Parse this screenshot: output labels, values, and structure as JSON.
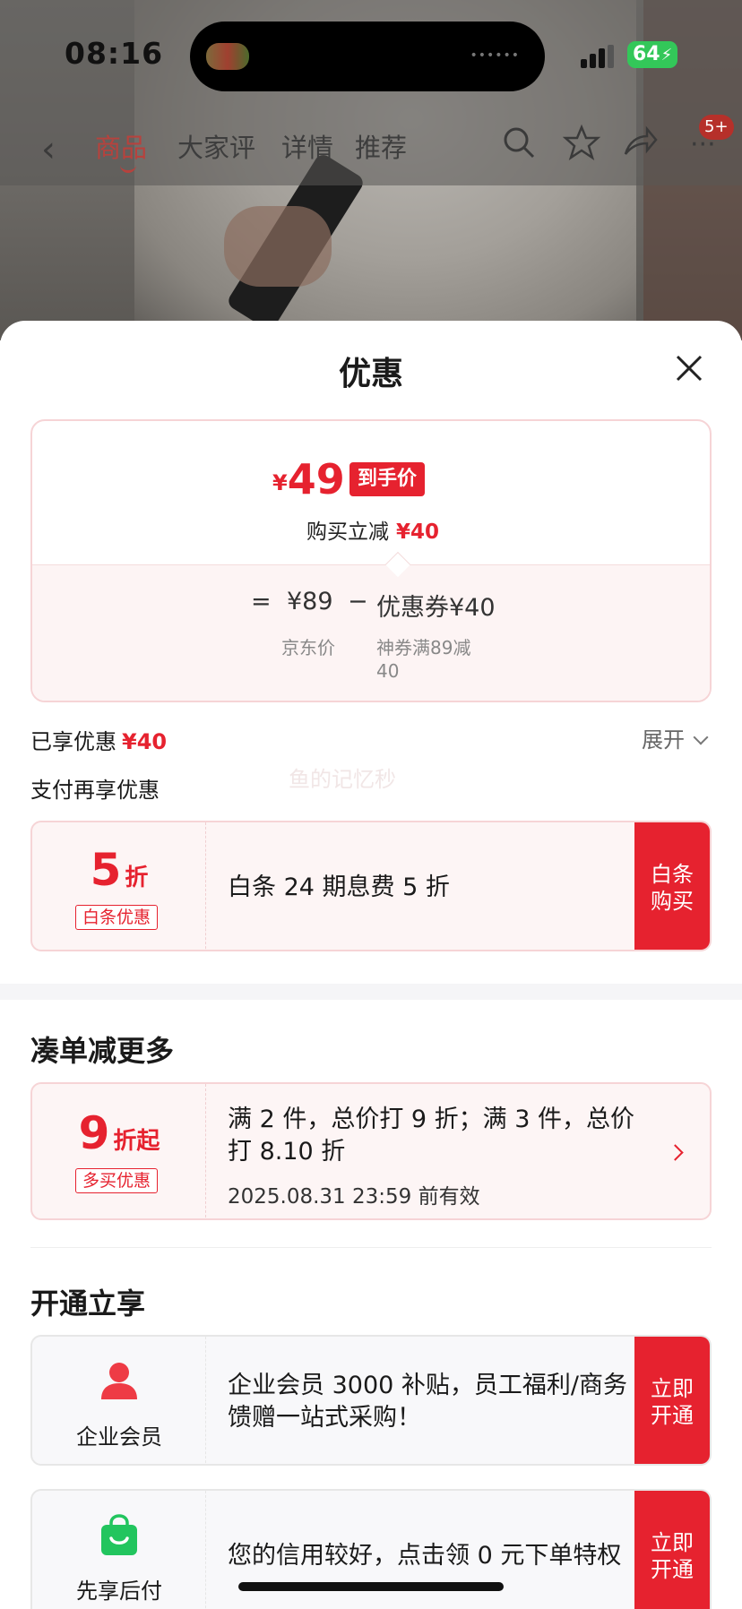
{
  "status_bar": {
    "time": "08:16",
    "battery": "64"
  },
  "product_nav": {
    "tabs": [
      "商品",
      "大家评",
      "详情",
      "推荐"
    ],
    "badge": "5+"
  },
  "sheet": {
    "title": "优惠",
    "price_card": {
      "currency": "¥",
      "final_price": "49",
      "final_tag": "到手价",
      "instant_text": "购买立减",
      "instant_amount": "¥40",
      "eq": "=",
      "jd_price": "¥89",
      "minus": "−",
      "coupon_text": "优惠券¥40",
      "jd_price_label": "京东价",
      "coupon_label_1": "神券满89减",
      "coupon_label_2": "40"
    },
    "enjoyed": {
      "label": "已享优惠",
      "amount": "¥40",
      "expand": "展开"
    },
    "pay_more_label": "支付再享优惠",
    "watermark": "鱼的记忆秒",
    "baitiao": {
      "num": "5",
      "unit": "折",
      "chip": "白条优惠",
      "desc": "白条 24 期息费 5 折",
      "action": "白条购买"
    },
    "bundle": {
      "title": "凑单减更多",
      "num": "9",
      "unit": "折起",
      "chip": "多买优惠",
      "desc": "满 2 件，总价打 9 折；满 3 件，总价打 8.10 折",
      "valid": "2025.08.31 23:59 前有效"
    },
    "open": {
      "title": "开通立享",
      "enterprise": {
        "label": "企业会员",
        "desc": " 企业会员 3000 补贴，员工福利/商务馈赠一站式采购！",
        "action": "立即开通"
      },
      "paylater": {
        "label": "先享后付",
        "desc": "您的信用较好，点击领 0 元下单特权",
        "action": "立即开通"
      }
    }
  },
  "colors": {
    "accent": "#e6222f",
    "card_border": "#f6d4d6",
    "card_bg": "#fdf5f5"
  }
}
